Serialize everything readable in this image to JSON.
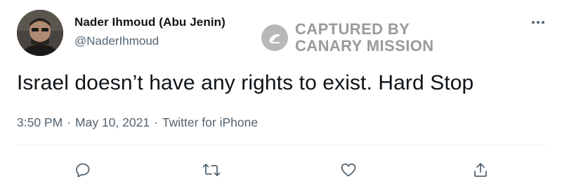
{
  "author": {
    "name": "Nader Ihmoud (Abu Jenin)",
    "handle": "@NaderIhmoud"
  },
  "watermark": {
    "line1": "CAPTURED BY",
    "line2": "CANARY MISSION"
  },
  "tweet": {
    "text": "Israel doesn’t have any rights to exist. Hard Stop"
  },
  "meta": {
    "time": "3:50 PM",
    "separator": "·",
    "date": "May 10, 2021",
    "source": "Twitter for iPhone"
  },
  "colors": {
    "text_primary": "#0f1419",
    "text_secondary": "#536471",
    "watermark": "#9a9a9a",
    "divider": "#e6ecf0"
  },
  "icons": {
    "more": "more-horizontal-icon",
    "reply": "reply-icon",
    "retweet": "retweet-icon",
    "like": "heart-icon",
    "share": "share-icon"
  }
}
